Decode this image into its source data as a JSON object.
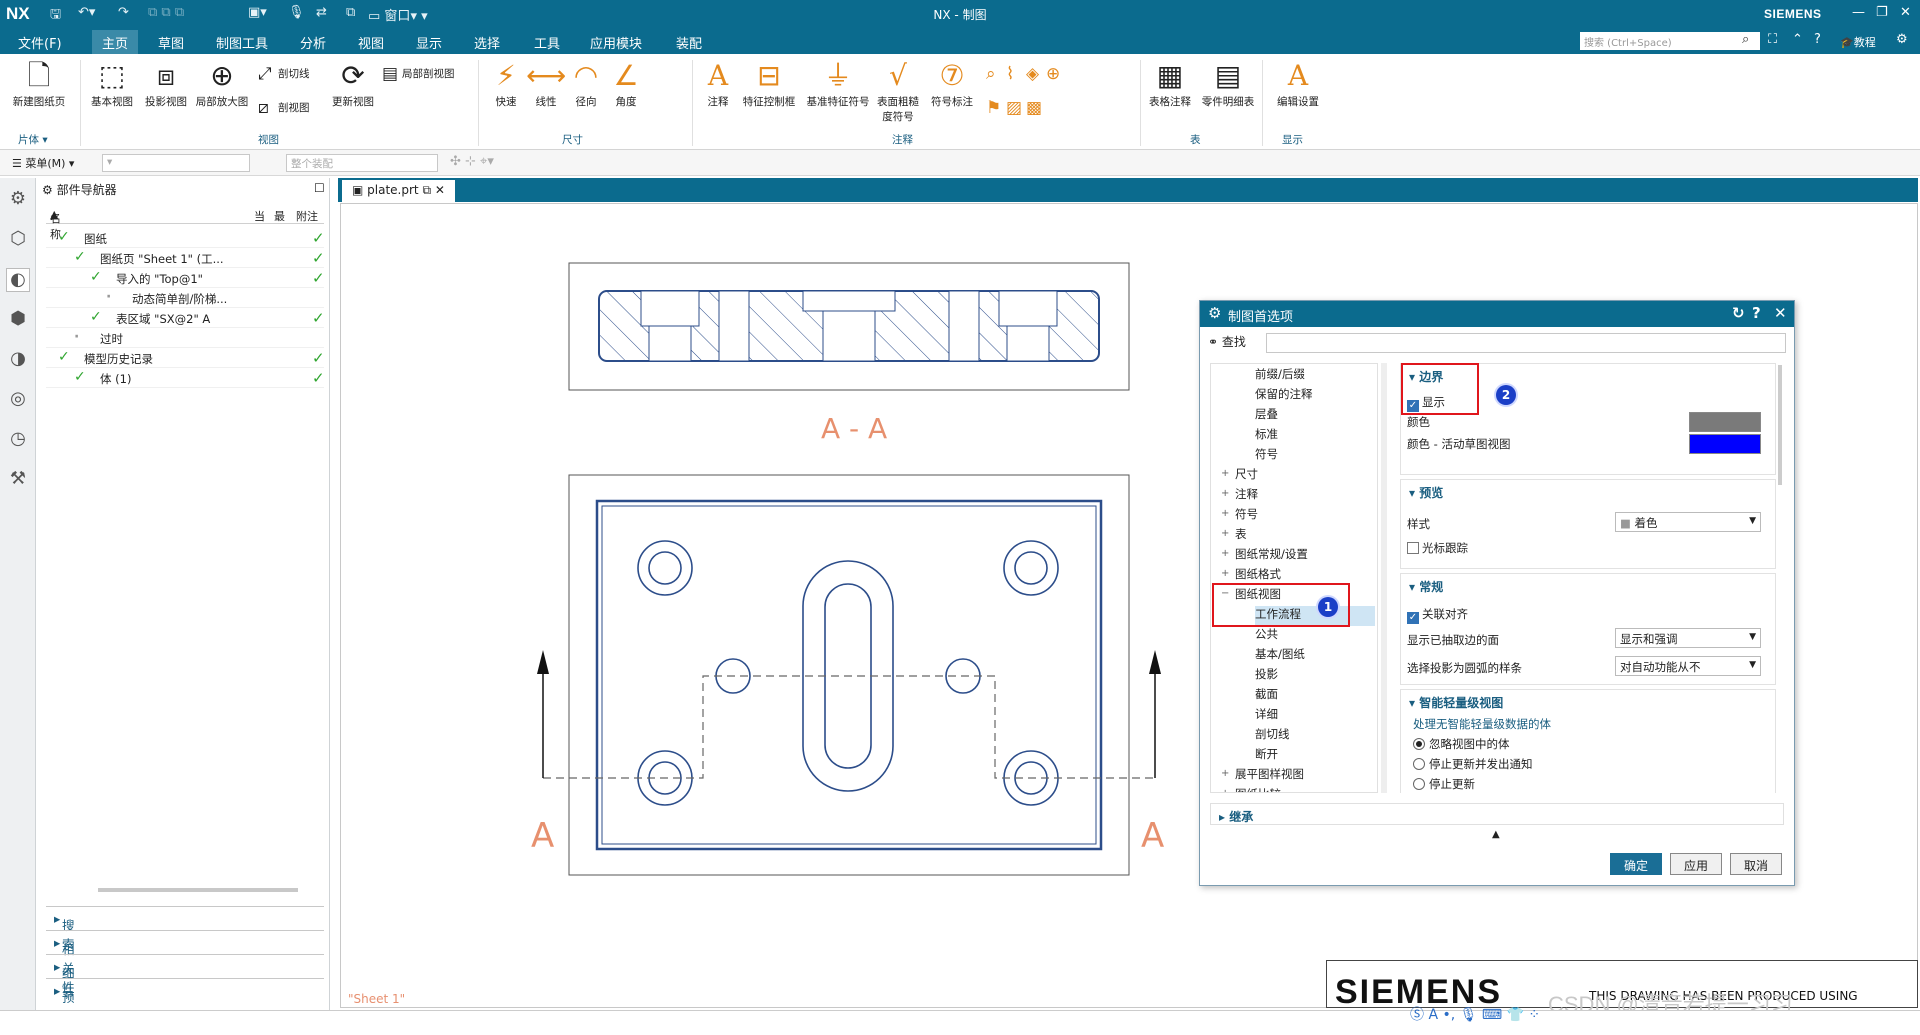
{
  "titlebar": {
    "logo": "NX",
    "title": "NX - 制图",
    "brand": "SIEMENS",
    "window_menu": "窗口"
  },
  "menubar": {
    "items": [
      "文件(F)",
      "主页",
      "草图",
      "制图工具",
      "分析",
      "视图",
      "显示",
      "选择",
      "工具",
      "应用模块",
      "装配"
    ],
    "active_index": 1,
    "search_placeholder": "搜索 (Ctrl+Space)",
    "tutorial": "教程"
  },
  "ribbon": {
    "new_sheet": "新建图纸页",
    "base_view": "基本视图",
    "proj_view": "投影视图",
    "detail_view": "局部放大图",
    "section_line": "剖切线",
    "section_view": "剖视图",
    "update_view": "更新视图",
    "break_section": "局部剖视图",
    "quick": "快速",
    "linear": "线性",
    "radial": "径向",
    "angle": "角度",
    "note": "注释",
    "fcf": "特征控制框",
    "datum": "基准特征符号",
    "surface": "表面粗糙度符号",
    "symbol_note": "符号标注",
    "table_note": "表格注释",
    "parts_list": "零件明细表",
    "edit_settings": "编辑设置",
    "groups": {
      "sheet": "片体",
      "view": "视图",
      "dim": "尺寸",
      "annot": "注释",
      "table": "表",
      "display": "显示"
    }
  },
  "toolbar2": {
    "menu": "菜单(M)",
    "combo2": "整个装配"
  },
  "navigator": {
    "title": "部件导航器",
    "cols": [
      "名称",
      "当",
      "最",
      "附注"
    ],
    "rows": [
      {
        "label": "图纸",
        "indent": 0,
        "check": true
      },
      {
        "label": "图纸页 \"Sheet 1\" (工...",
        "indent": 1,
        "check": true
      },
      {
        "label": "导入的 \"Top@1\"",
        "indent": 2,
        "check": true
      },
      {
        "label": "动态简单剖/阶梯...",
        "indent": 3,
        "check": false
      },
      {
        "label": "表区域 \"SX@2\" A",
        "indent": 2,
        "check": true
      },
      {
        "label": "过时",
        "indent": 1,
        "check": false
      },
      {
        "label": "模型历史记录",
        "indent": 0,
        "check": true
      },
      {
        "label": "体 (1)",
        "indent": 1,
        "check": true
      }
    ],
    "panels": [
      "搜索",
      "相关性",
      "细节",
      "预览"
    ]
  },
  "document": {
    "tab": "plate.prt",
    "section_label": "A - A",
    "arrow_label_left": "A",
    "arrow_label_right": "A",
    "sheet_label": "\"Sheet 1\"",
    "siemens_logo": "SIEMENS",
    "produced_text": "THIS DRAWING HAS BEEN PRODUCED USING"
  },
  "watermark": "CSDN @清音若提一习习",
  "dialog": {
    "title": "制图首选项",
    "search_label": "查找",
    "tree": [
      {
        "label": "前缀/后缀",
        "level": 2
      },
      {
        "label": "保留的注释",
        "level": 2
      },
      {
        "label": "层叠",
        "level": 2
      },
      {
        "label": "标准",
        "level": 2
      },
      {
        "label": "符号",
        "level": 2
      },
      {
        "label": "尺寸",
        "level": 1
      },
      {
        "label": "注释",
        "level": 1
      },
      {
        "label": "符号",
        "level": 1
      },
      {
        "label": "表",
        "level": 1
      },
      {
        "label": "图纸常规/设置",
        "level": 1
      },
      {
        "label": "图纸格式",
        "level": 1
      },
      {
        "label": "图纸视图",
        "level": 1
      },
      {
        "label": "工作流程",
        "level": 2,
        "selected": true
      },
      {
        "label": "公共",
        "level": 2
      },
      {
        "label": "基本/图纸",
        "level": 2
      },
      {
        "label": "投影",
        "level": 2
      },
      {
        "label": "截面",
        "level": 2
      },
      {
        "label": "详细",
        "level": 2
      },
      {
        "label": "剖切线",
        "level": 2
      },
      {
        "label": "断开",
        "level": 2
      },
      {
        "label": "展平图样视图",
        "level": 1
      },
      {
        "label": "图纸比较",
        "level": 1
      }
    ],
    "sections": {
      "border": {
        "title": "边界",
        "show": "显示",
        "color": "颜色",
        "color_active": "颜色 - 活动草图视图",
        "color1": "#7a7a7a",
        "color2": "#0000ff"
      },
      "preview": {
        "title": "预览",
        "style_label": "样式",
        "style_value": "着色",
        "cursor_track": "光标跟踪"
      },
      "general": {
        "title": "常规",
        "assoc_align": "关联对齐",
        "edge_label": "显示已抽取边的面",
        "edge_value": "显示和强调",
        "spline_label": "选择投影为圆弧的样条",
        "spline_value": "对自动功能从不"
      },
      "smart": {
        "title": "智能轻量级视图",
        "subtitle": "处理无智能轻量级数据的体",
        "opt1": "忽略视图中的体",
        "opt2": "停止更新并发出通知",
        "opt3": "停止更新"
      },
      "inherit": {
        "title": "继承"
      }
    },
    "buttons": {
      "ok": "确定",
      "apply": "应用",
      "cancel": "取消"
    },
    "badges": [
      "1",
      "2"
    ]
  }
}
